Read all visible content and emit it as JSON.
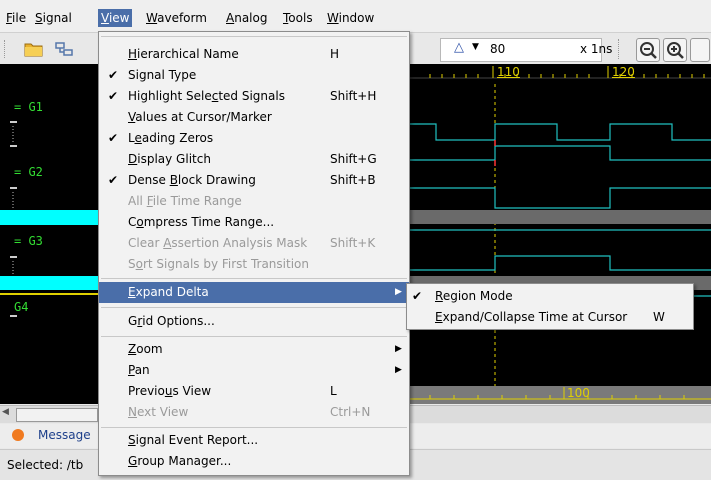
{
  "menubar": {
    "items": [
      {
        "label": "File",
        "mnemonic": "F",
        "rest": "ile"
      },
      {
        "label": "Signal",
        "mnemonic": "S",
        "rest": "ignal"
      },
      {
        "label": "View",
        "mnemonic": "V",
        "rest": "iew"
      },
      {
        "label": "Waveform",
        "mnemonic": "W",
        "rest": "aveform"
      },
      {
        "label": "Analog",
        "mnemonic": "A",
        "rest": "nalog"
      },
      {
        "label": "Tools",
        "mnemonic": "T",
        "rest": "ools"
      },
      {
        "label": "Window",
        "mnemonic": "W",
        "rest": "indow"
      }
    ]
  },
  "toolbar": {
    "zoom_value": "80",
    "time_unit": "x 1ns"
  },
  "signals": {
    "g1": "G1",
    "g2": "G2",
    "g3": "G3",
    "g4": "G4"
  },
  "ruler": {
    "tick_110": "110",
    "tick_120": "120",
    "bottom_tick": "100"
  },
  "view_menu": {
    "items": [
      {
        "label_pre": "",
        "mnem": "H",
        "label_post": "ierarchical Name",
        "accel": "H",
        "checked": false,
        "disabled": false
      },
      {
        "label_pre": "Signal Type",
        "mnem": "",
        "label_post": "",
        "accel": "",
        "checked": true,
        "disabled": false
      },
      {
        "label_pre": "Highlight Sele",
        "mnem": "c",
        "label_post": "ted Signals",
        "accel": "Shift+H",
        "checked": true,
        "disabled": false
      },
      {
        "label_pre": "",
        "mnem": "V",
        "label_post": "alues at Cursor/Marker",
        "accel": "",
        "checked": false,
        "disabled": false
      },
      {
        "label_pre": "L",
        "mnem": "e",
        "label_post": "ading Zeros",
        "accel": "",
        "checked": true,
        "disabled": false
      },
      {
        "label_pre": "",
        "mnem": "D",
        "label_post": "isplay Glitch",
        "accel": "Shift+G",
        "checked": false,
        "disabled": false
      },
      {
        "label_pre": "Dense ",
        "mnem": "B",
        "label_post": "lock Drawing",
        "accel": "Shift+B",
        "checked": true,
        "disabled": false
      },
      {
        "label_pre": "All ",
        "mnem": "F",
        "label_post": "ile Time Range",
        "accel": "",
        "checked": false,
        "disabled": true
      },
      {
        "label_pre": "C",
        "mnem": "o",
        "label_post": "mpress Time Range...",
        "accel": "",
        "checked": false,
        "disabled": false
      },
      {
        "label_pre": "Clear ",
        "mnem": "A",
        "label_post": "ssertion Analysis Mask",
        "accel": "Shift+K",
        "checked": false,
        "disabled": true
      },
      {
        "label_pre": "S",
        "mnem": "o",
        "label_post": "rt Signals by First Transition",
        "accel": "",
        "checked": false,
        "disabled": true
      },
      {
        "label_pre": "",
        "mnem": "E",
        "label_post": "xpand Delta",
        "accel": "",
        "checked": false,
        "disabled": false,
        "submenu": true,
        "highlight": true
      },
      {
        "label_pre": "G",
        "mnem": "r",
        "label_post": "id Options...",
        "accel": "",
        "checked": false,
        "disabled": false
      },
      {
        "label_pre": "",
        "mnem": "Z",
        "label_post": "oom",
        "accel": "",
        "checked": false,
        "disabled": false,
        "submenu": true
      },
      {
        "label_pre": "",
        "mnem": "P",
        "label_post": "an",
        "accel": "",
        "checked": false,
        "disabled": false,
        "submenu": true
      },
      {
        "label_pre": "Previo",
        "mnem": "u",
        "label_post": "s View",
        "accel": "L",
        "checked": false,
        "disabled": false
      },
      {
        "label_pre": "",
        "mnem": "N",
        "label_post": "ext View",
        "accel": "Ctrl+N",
        "checked": false,
        "disabled": true
      },
      {
        "label_pre": "",
        "mnem": "S",
        "label_post": "ignal Event Report...",
        "accel": "",
        "checked": false,
        "disabled": false
      },
      {
        "label_pre": "",
        "mnem": "G",
        "label_post": "roup Manager...",
        "accel": "",
        "checked": false,
        "disabled": false
      }
    ]
  },
  "sub_menu": {
    "items": [
      {
        "label_pre": "",
        "mnem": "R",
        "label_post": "egion Mode",
        "accel": "",
        "checked": true
      },
      {
        "label_pre": "",
        "mnem": "E",
        "label_post": "xpand/Collapse Time at Cursor",
        "accel": "W",
        "checked": false
      }
    ]
  },
  "message_tab": "Message",
  "status_text": "Selected: /tb",
  "check_glyph": "✔",
  "arrow_glyph": "▶",
  "colors": {
    "menu_highlight": "#4a6ea9",
    "signal_name": "#33dd33",
    "waveform": "#20c0c0",
    "cursor": "#e0d000",
    "highlight_row": "#00ffff",
    "ruler_text": "#e0d000"
  }
}
